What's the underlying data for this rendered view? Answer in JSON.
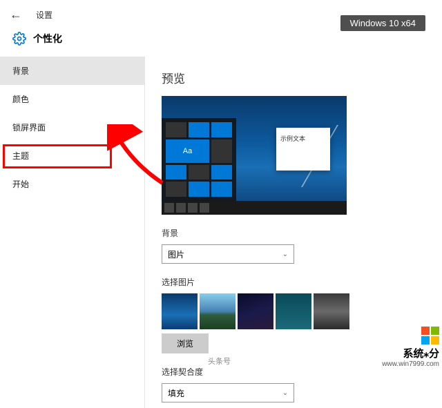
{
  "header": {
    "settings_label": "设置"
  },
  "title": "个性化",
  "os_badge": "Windows 10 x64",
  "sidebar": {
    "items": [
      {
        "label": "背景",
        "active": true
      },
      {
        "label": "颜色"
      },
      {
        "label": "锁屏界面"
      },
      {
        "label": "主题",
        "highlighted": true
      },
      {
        "label": "开始"
      }
    ]
  },
  "main": {
    "preview_title": "预览",
    "sample_text": "示例文本",
    "tile_aa": "Aa",
    "background_label": "背景",
    "background_value": "图片",
    "choose_picture_label": "选择图片",
    "browse_label": "浏览",
    "fit_label": "选择契合度",
    "fit_value": "填充"
  },
  "watermark": {
    "title": "系统⁎分",
    "url": "www.win7999.com"
  },
  "author_badge": "头条号"
}
